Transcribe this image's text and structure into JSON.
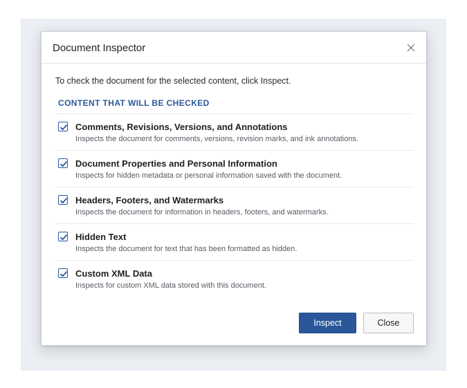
{
  "dialog": {
    "title": "Document Inspector",
    "instruction": "To check the document for the selected content, click Inspect.",
    "section_title": "CONTENT THAT WILL BE CHECKED",
    "items": [
      {
        "title": "Comments, Revisions, Versions, and Annotations",
        "description": "Inspects the document for comments, versions, revision marks, and ink annotations.",
        "checked": true
      },
      {
        "title": "Document Properties and Personal Information",
        "description": "Inspects for hidden metadata or personal information saved with the document.",
        "checked": true
      },
      {
        "title": "Headers, Footers, and Watermarks",
        "description": "Inspects the document for information in headers, footers, and watermarks.",
        "checked": true
      },
      {
        "title": "Hidden Text",
        "description": "Inspects the document for text that has been formatted as hidden.",
        "checked": true
      },
      {
        "title": "Custom XML Data",
        "description": "Inspects for custom XML data stored with this document.",
        "checked": true
      }
    ],
    "buttons": {
      "inspect_label": "Inspect",
      "close_label": "Close"
    },
    "icons": {
      "close": "close-icon",
      "check": "checkmark-icon"
    },
    "colors": {
      "accent": "#2b579a",
      "backdrop": "#ebeef3"
    }
  }
}
